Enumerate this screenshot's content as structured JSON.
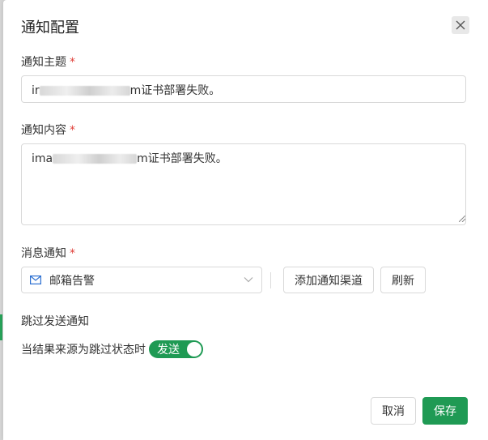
{
  "dialog": {
    "title": "通知配置",
    "close_icon": "close-icon"
  },
  "subject": {
    "label": "通知主题",
    "required_mark": "*",
    "prefix": "ir",
    "suffix": "m证书部署失败。"
  },
  "content": {
    "label": "通知内容",
    "required_mark": "*",
    "prefix": "ima",
    "suffix": "m证书部署失败。"
  },
  "message_notify": {
    "label": "消息通知",
    "required_mark": "*",
    "select_icon": "mail-icon",
    "selected": "邮箱告警",
    "add_channel_label": "添加通知渠道",
    "refresh_label": "刷新"
  },
  "skip": {
    "section_label": "跳过发送通知",
    "condition_text": "当结果来源为跳过状态时",
    "toggle_label": "发送",
    "toggle_on": true
  },
  "footer": {
    "cancel_label": "取消",
    "save_label": "保存"
  },
  "colors": {
    "primary": "#1f9a54",
    "required": "#e0403a",
    "border": "#d9d9d9"
  }
}
